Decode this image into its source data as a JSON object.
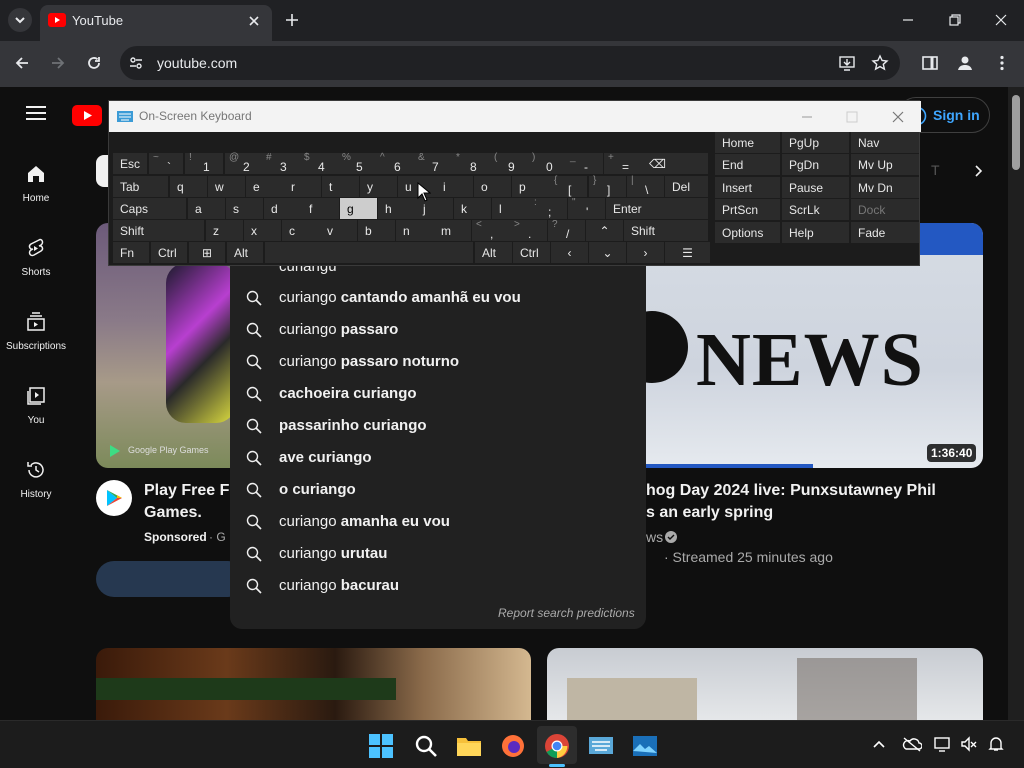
{
  "browser": {
    "tab_title": "YouTube",
    "url": "youtube.com"
  },
  "youtube": {
    "sign_in": "Sign in",
    "nav": [
      {
        "label": "Home",
        "icon": "home-icon"
      },
      {
        "label": "Shorts",
        "icon": "shorts-icon"
      },
      {
        "label": "Subscriptions",
        "icon": "subscriptions-icon"
      },
      {
        "label": "You",
        "icon": "you-icon"
      },
      {
        "label": "History",
        "icon": "history-icon"
      }
    ],
    "chip_partial": "T",
    "video1": {
      "title_line1": "Play Free Fi",
      "title_line2": "Games.",
      "sponsored": "Sponsored",
      "channel_partial": "· G",
      "thumb_caption": "Google Play Games"
    },
    "video2": {
      "title_line1": "hog Day 2024 live: Punxsutawney Phil",
      "title_line2": "s an early spring",
      "channel_partial": "ws",
      "meta": "· Streamed 25 minutes ago",
      "duration": "1:36:40",
      "thumb_text": "NEWS"
    }
  },
  "search": {
    "query_partial": "curiangu",
    "suggestions": [
      {
        "prefix": "curiango",
        "rest": " cantando amanhã eu vou"
      },
      {
        "prefix": "curiango",
        "rest": " passaro"
      },
      {
        "prefix": "curiango",
        "rest": " passaro noturno"
      },
      {
        "prefix": "",
        "rest": "cachoeira curiango"
      },
      {
        "prefix": "",
        "rest": "passarinho curiango"
      },
      {
        "prefix": "",
        "rest": "ave curiango"
      },
      {
        "prefix": "",
        "rest": "o curiango"
      },
      {
        "prefix": "curiango",
        "rest": " amanha eu vou"
      },
      {
        "prefix": "curiango",
        "rest": " urutau"
      },
      {
        "prefix": "curiango",
        "rest": " bacurau"
      }
    ],
    "report": "Report search predictions"
  },
  "osk": {
    "title": "On-Screen Keyboard",
    "row1": [
      {
        "m": "Esc"
      },
      {
        "s": "~",
        "m": "`"
      },
      {
        "s": "!",
        "m": "1"
      },
      {
        "s": "@",
        "m": "2"
      },
      {
        "s": "#",
        "m": "3"
      },
      {
        "s": "$",
        "m": "4"
      },
      {
        "s": "%",
        "m": "5"
      },
      {
        "s": "^",
        "m": "6"
      },
      {
        "s": "&",
        "m": "7"
      },
      {
        "s": "*",
        "m": "8"
      },
      {
        "s": "(",
        "m": "9"
      },
      {
        "s": ")",
        "m": "0"
      },
      {
        "s": "_",
        "m": "-"
      },
      {
        "s": "+",
        "m": "="
      },
      {
        "m": "⌫"
      }
    ],
    "row2": [
      {
        "m": "Tab"
      },
      {
        "m": "q"
      },
      {
        "m": "w"
      },
      {
        "m": "e"
      },
      {
        "m": "r"
      },
      {
        "m": "t"
      },
      {
        "m": "y"
      },
      {
        "m": "u"
      },
      {
        "m": "i"
      },
      {
        "m": "o"
      },
      {
        "m": "p"
      },
      {
        "s": "{",
        "m": "["
      },
      {
        "s": "}",
        "m": "]"
      },
      {
        "s": "|",
        "m": "\\"
      },
      {
        "m": "Del"
      }
    ],
    "row3": [
      {
        "m": "Caps"
      },
      {
        "m": "a"
      },
      {
        "m": "s"
      },
      {
        "m": "d"
      },
      {
        "m": "f"
      },
      {
        "m": "g"
      },
      {
        "m": "h"
      },
      {
        "m": "j"
      },
      {
        "m": "k"
      },
      {
        "m": "l"
      },
      {
        "s": ":",
        "m": ";"
      },
      {
        "s": "\"",
        "m": "'"
      },
      {
        "m": "Enter"
      }
    ],
    "row4": [
      {
        "m": "Shift"
      },
      {
        "m": "z"
      },
      {
        "m": "x"
      },
      {
        "m": "c"
      },
      {
        "m": "v"
      },
      {
        "m": "b"
      },
      {
        "m": "n"
      },
      {
        "m": "m"
      },
      {
        "s": "<",
        "m": ","
      },
      {
        "s": ">",
        "m": "."
      },
      {
        "s": "?",
        "m": "/"
      },
      {
        "m": "⌃"
      },
      {
        "m": "Shift"
      }
    ],
    "row5": [
      {
        "m": "Fn"
      },
      {
        "m": "Ctrl"
      },
      {
        "m": "⊞"
      },
      {
        "m": "Alt"
      },
      {
        "m": ""
      },
      {
        "m": "Alt"
      },
      {
        "m": "Ctrl"
      },
      {
        "m": "‹"
      },
      {
        "m": "⌄"
      },
      {
        "m": "›"
      },
      {
        "m": "☰"
      }
    ],
    "nav_keys": [
      [
        "Home",
        "PgUp",
        "Nav"
      ],
      [
        "End",
        "PgDn",
        "Mv Up"
      ],
      [
        "Insert",
        "Pause",
        "Mv Dn"
      ],
      [
        "PrtScn",
        "ScrLk",
        "Dock"
      ],
      [
        "Options",
        "Help",
        "Fade"
      ]
    ],
    "highlighted_key": "g"
  },
  "taskbar": {
    "apps": [
      "windows-start-icon",
      "search-icon",
      "file-explorer-icon",
      "firefox-icon",
      "chrome-icon",
      "osk-app-icon",
      "photos-icon"
    ]
  },
  "colors": {
    "youtube_red": "#ff0000",
    "link_blue": "#3ea6ff",
    "chrome_bg": "#202124",
    "toolbar": "#35363a"
  }
}
